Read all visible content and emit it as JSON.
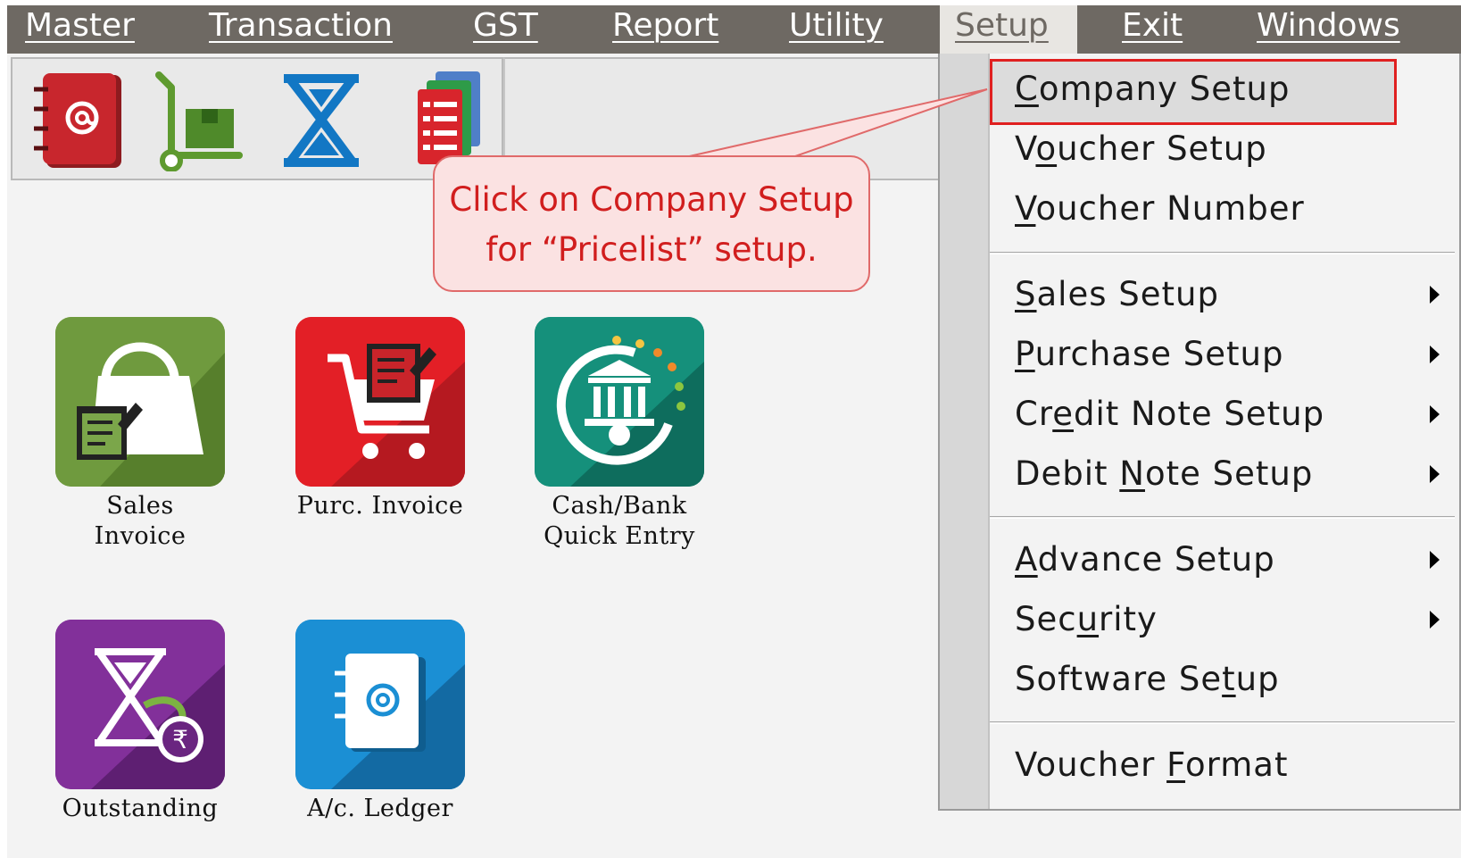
{
  "menubar": {
    "items": [
      {
        "label": "Master",
        "active": false
      },
      {
        "label": "Transaction",
        "active": false
      },
      {
        "label": "GST",
        "active": false
      },
      {
        "label": "Report",
        "active": false
      },
      {
        "label": "Utility",
        "active": false
      },
      {
        "label": "Setup",
        "active": true
      },
      {
        "label": "Exit",
        "active": false
      },
      {
        "label": "Windows",
        "active": false
      }
    ]
  },
  "toolbar": {
    "icons": [
      "address-book-icon",
      "trolley-box-icon",
      "hourglass-rupee-icon",
      "stacked-reports-icon"
    ]
  },
  "tiles": [
    {
      "label_line1": "Sales",
      "label_line2": "Invoice",
      "icon": "shopping-bag-icon",
      "color": "#6f9a3e"
    },
    {
      "label_line1": "Purc. Invoice",
      "label_line2": "",
      "icon": "shopping-cart-icon",
      "color": "#d92027"
    },
    {
      "label_line1": "Cash/Bank",
      "label_line2": "Quick Entry",
      "icon": "bank-icon",
      "color": "#12826f"
    },
    {
      "label_line1": "Outstanding",
      "label_line2": "",
      "icon": "hourglass-rupee-icon",
      "color": "#7b2a8c"
    },
    {
      "label_line1": "A/c. Ledger",
      "label_line2": "",
      "icon": "ledger-book-icon",
      "color": "#1a86c8"
    }
  ],
  "callout": {
    "line1": "Click on Company Setup",
    "line2": "for “Pricelist” setup."
  },
  "dropdown": {
    "items": [
      {
        "before": "",
        "mnemonic": "C",
        "after": "ompany Setup",
        "submenu": false,
        "highlighted": true
      },
      {
        "before": "V",
        "mnemonic": "o",
        "after": "ucher Setup",
        "submenu": false
      },
      {
        "before": "",
        "mnemonic": "V",
        "after": "oucher Number",
        "submenu": false
      },
      {
        "before": "",
        "mnemonic": "S",
        "after": "ales Setup",
        "submenu": true
      },
      {
        "before": "",
        "mnemonic": "P",
        "after": "urchase Setup",
        "submenu": true
      },
      {
        "before": "Cr",
        "mnemonic": "e",
        "after": "dit Note Setup",
        "submenu": true
      },
      {
        "before": "Debit ",
        "mnemonic": "N",
        "after": "ote Setup",
        "submenu": true
      },
      {
        "before": "",
        "mnemonic": "A",
        "after": "dvance Setup",
        "submenu": true
      },
      {
        "before": "Sec",
        "mnemonic": "u",
        "after": "rity",
        "submenu": true
      },
      {
        "before": "Software Se",
        "mnemonic": "t",
        "after": "up",
        "submenu": false
      },
      {
        "before": "Voucher ",
        "mnemonic": "F",
        "after": "ormat",
        "submenu": false
      }
    ]
  },
  "colors": {
    "menubar": "#6e6963",
    "highlight_border": "#e02020",
    "callout_text": "#d11e1e"
  }
}
